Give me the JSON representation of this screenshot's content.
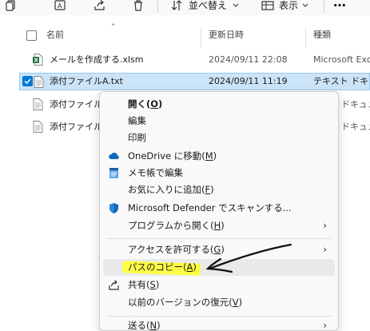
{
  "toolbar": {
    "sort_label": "並べ替え",
    "view_label": "表示",
    "more_label": "…"
  },
  "columns": {
    "name": "名前",
    "modified": "更新日時",
    "type": "種類"
  },
  "files": [
    {
      "name": "メールを作成する.xlsm",
      "modified": "2024/09/11 22:08",
      "type": "Microsoft Exc"
    },
    {
      "name": "添付ファイルA.txt",
      "modified": "2024/09/11 11:19",
      "type": "テキスト ドキュメ"
    },
    {
      "name": "添付ファイルB",
      "modified": "",
      "type": "ドキュメ"
    },
    {
      "name": "添付ファイルC",
      "modified": "",
      "type": "ドキュメ"
    }
  ],
  "menu": {
    "items": [
      {
        "label": "開く(",
        "key": "O",
        "tail": ")"
      },
      {
        "label": "編集"
      },
      {
        "label": "印刷"
      },
      {
        "label": "OneDrive に移動(",
        "key": "M",
        "tail": ")"
      },
      {
        "label": "メモ帳で編集"
      },
      {
        "label": "お気に入りに追加(",
        "key": "F",
        "tail": ")"
      },
      {
        "label": "Microsoft Defender でスキャンする..."
      },
      {
        "label": "プログラムから開く(",
        "key": "H",
        "tail": ")"
      },
      {
        "label": "アクセスを許可する(",
        "key": "G",
        "tail": ")"
      },
      {
        "label": "パスのコピー(",
        "key": "A",
        "tail": ")"
      },
      {
        "label": "共有(",
        "key": "S",
        "tail": ")"
      },
      {
        "label": "以前のバージョンの復元(",
        "key": "V",
        "tail": ")"
      },
      {
        "label": "送る(",
        "key": "N",
        "tail": ")"
      }
    ]
  },
  "colors": {
    "selection": "#cce4f7",
    "highlight": "#ffff33",
    "accent": "#0078d4"
  },
  "icons": [
    "copy-icon",
    "rename-icon",
    "share-icon",
    "trash-icon",
    "sort-icon",
    "view-icon",
    "chevron-down-icon",
    "excel-file-icon",
    "text-file-icon",
    "onedrive-icon",
    "notepad-icon",
    "defender-icon",
    "share-icon",
    "chevron-right-icon"
  ]
}
